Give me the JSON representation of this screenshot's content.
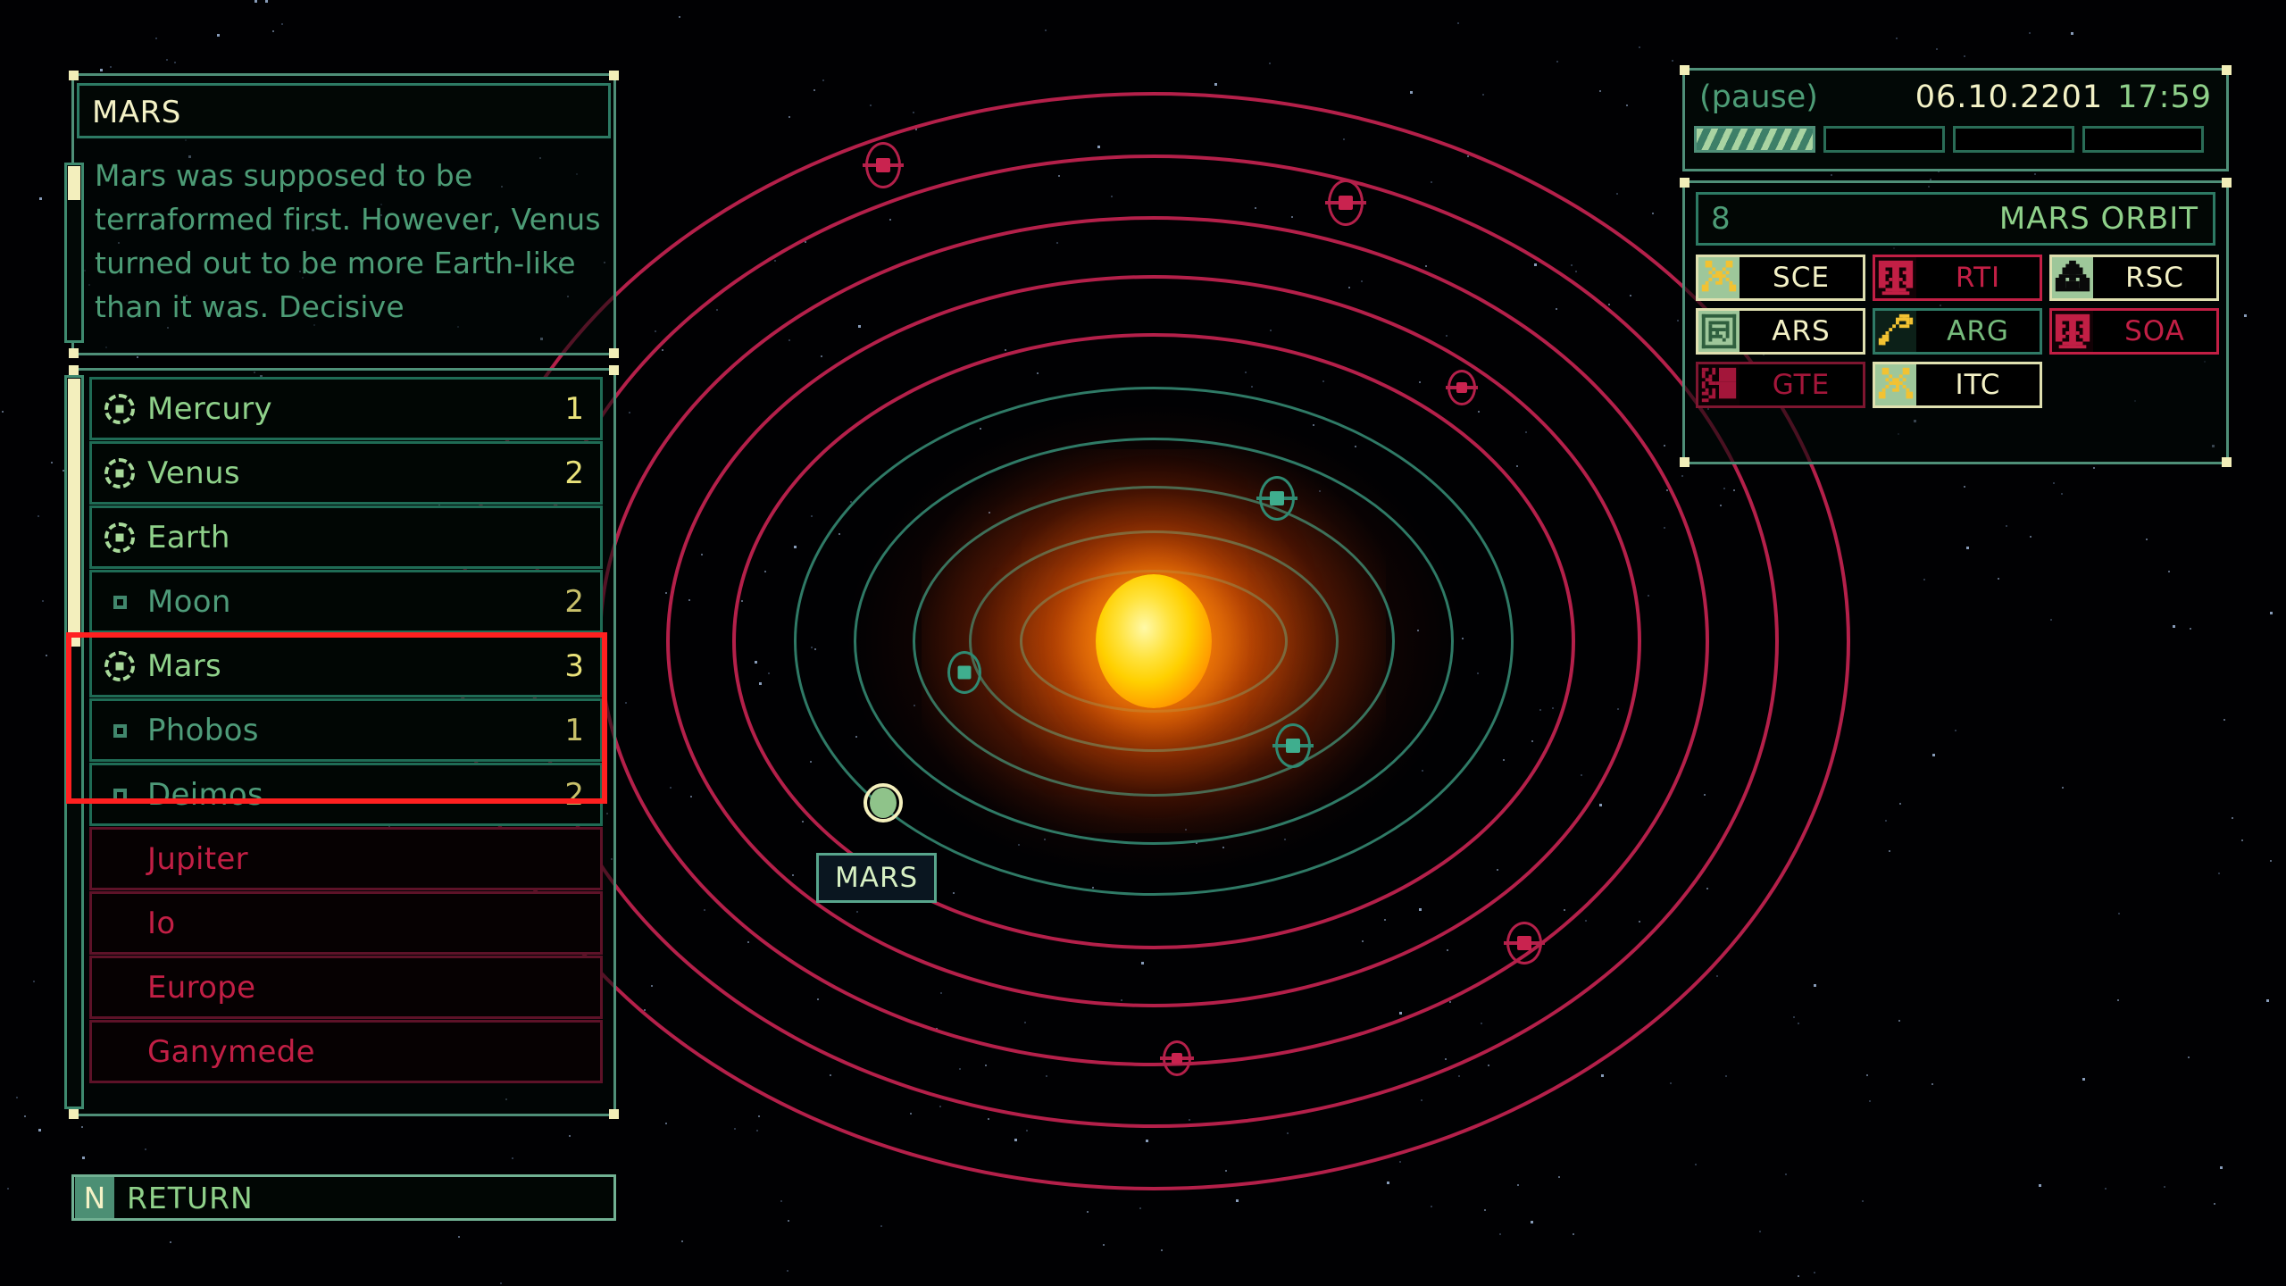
{
  "info": {
    "title": "MARS",
    "description": "Mars was supposed to be terraformed first. However, Venus turned out to be more Earth-like than it was. Decisive"
  },
  "body_list": {
    "items": [
      {
        "name": "Mercury",
        "count": "1",
        "icon": "planet-icon",
        "kind": "planet",
        "state": "available"
      },
      {
        "name": "Venus",
        "count": "2",
        "icon": "planet-icon",
        "kind": "planet",
        "state": "available"
      },
      {
        "name": "Earth",
        "count": "",
        "icon": "planet-icon",
        "kind": "planet",
        "state": "available"
      },
      {
        "name": "Moon",
        "count": "2",
        "icon": "moon-icon",
        "kind": "moon",
        "state": "available"
      },
      {
        "name": "Mars",
        "count": "3",
        "icon": "planet-icon",
        "kind": "planet",
        "state": "selected"
      },
      {
        "name": "Phobos",
        "count": "1",
        "icon": "moon-icon",
        "kind": "moon",
        "state": "selected"
      },
      {
        "name": "Deimos",
        "count": "2",
        "icon": "moon-icon",
        "kind": "moon",
        "state": "selected"
      },
      {
        "name": "Jupiter",
        "count": "",
        "icon": "none",
        "kind": "planet",
        "state": "locked"
      },
      {
        "name": "Io",
        "count": "",
        "icon": "none",
        "kind": "moon",
        "state": "locked"
      },
      {
        "name": "Europe",
        "count": "",
        "icon": "none",
        "kind": "moon",
        "state": "locked"
      },
      {
        "name": "Ganymede",
        "count": "",
        "icon": "none",
        "kind": "moon",
        "state": "locked"
      }
    ],
    "selection_color": "#ff2020"
  },
  "return_button": {
    "key": "N",
    "label": "RETURN"
  },
  "clock": {
    "pause_label": "(pause)",
    "date": "06.10.2201",
    "time": "17:59",
    "speed_steps": 4,
    "active_speed": 1
  },
  "orbit_panel": {
    "index": "8",
    "name": "MARS ORBIT",
    "buttons": [
      {
        "label": "SCE",
        "icon": "crossed-tools-icon",
        "style": "cream",
        "icon_color": "#f2c232"
      },
      {
        "label": "RTI",
        "icon": "factory-icon",
        "style": "red",
        "icon_color": "#c21f45"
      },
      {
        "label": "RSC",
        "icon": "resource-icon",
        "style": "cream",
        "icon_color": "#0a0a0a"
      },
      {
        "label": "ARS",
        "icon": "chart-icon",
        "style": "cream",
        "icon_color": "#2f5f3e"
      },
      {
        "label": "ARG",
        "icon": "key-icon",
        "style": "green",
        "icon_color": "#f2c232"
      },
      {
        "label": "SOA",
        "icon": "factory-icon",
        "style": "red",
        "icon_color": "#c21f45"
      },
      {
        "label": "GTE",
        "icon": "gate-icon",
        "style": "darkred",
        "icon_color": "#a3163a"
      },
      {
        "label": "ITC",
        "icon": "crossed-tools-icon",
        "style": "cream",
        "icon_color": "#f2c232"
      }
    ]
  },
  "map": {
    "selected_label": "MARS",
    "sun_color": "#ffd000",
    "inner_orbit_color": "#2f7a66",
    "outer_orbit_color": "#b4204a"
  }
}
